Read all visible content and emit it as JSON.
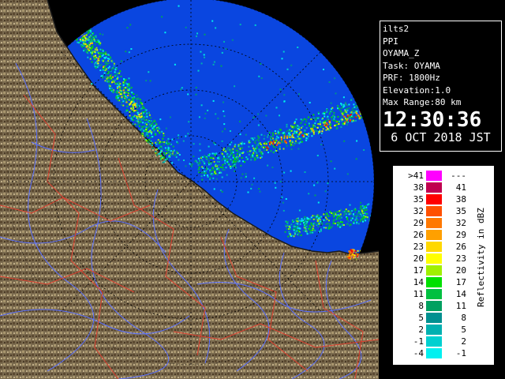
{
  "radar": {
    "colors": {
      "background": "#000000",
      "sweep": "#0a46e0",
      "sweep_far": "#0d52f0",
      "land": "#7a6a4e",
      "river": "#5a70ff",
      "border": "#e04030"
    }
  },
  "info": {
    "radar_name": "ilts2",
    "scan_type": "PPI",
    "product": "OYAMA_Z",
    "task": "Task: OYAMA",
    "prf": "PRF: 1800Hz",
    "elevation": "Elevation:1.0",
    "max_range": "Max Range:80 km",
    "time": "12:30:36",
    "date": "6 OCT 2018 JST"
  },
  "legend": {
    "unit_label": "Reflectivity in dBZ",
    "rows": [
      {
        "lo": ">41",
        "hi": "---",
        "color": "#ff00ff"
      },
      {
        "lo": "38",
        "hi": "41",
        "color": "#c00050"
      },
      {
        "lo": "35",
        "hi": "38",
        "color": "#ff0000"
      },
      {
        "lo": "32",
        "hi": "35",
        "color": "#ff5000"
      },
      {
        "lo": "29",
        "hi": "32",
        "color": "#ff7800"
      },
      {
        "lo": "26",
        "hi": "29",
        "color": "#ffa000"
      },
      {
        "lo": "23",
        "hi": "26",
        "color": "#ffd800"
      },
      {
        "lo": "20",
        "hi": "23",
        "color": "#ffff00"
      },
      {
        "lo": "17",
        "hi": "20",
        "color": "#a0f000"
      },
      {
        "lo": "14",
        "hi": "17",
        "color": "#00e000"
      },
      {
        "lo": "11",
        "hi": "14",
        "color": "#00c040"
      },
      {
        "lo": "8",
        "hi": "11",
        "color": "#00a060"
      },
      {
        "lo": "5",
        "hi": "8",
        "color": "#009090"
      },
      {
        "lo": "2",
        "hi": "5",
        "color": "#00b0b0"
      },
      {
        "lo": "-1",
        "hi": "2",
        "color": "#00d0d0"
      },
      {
        "lo": "-4",
        "hi": "-1",
        "color": "#00f0f0"
      }
    ]
  }
}
